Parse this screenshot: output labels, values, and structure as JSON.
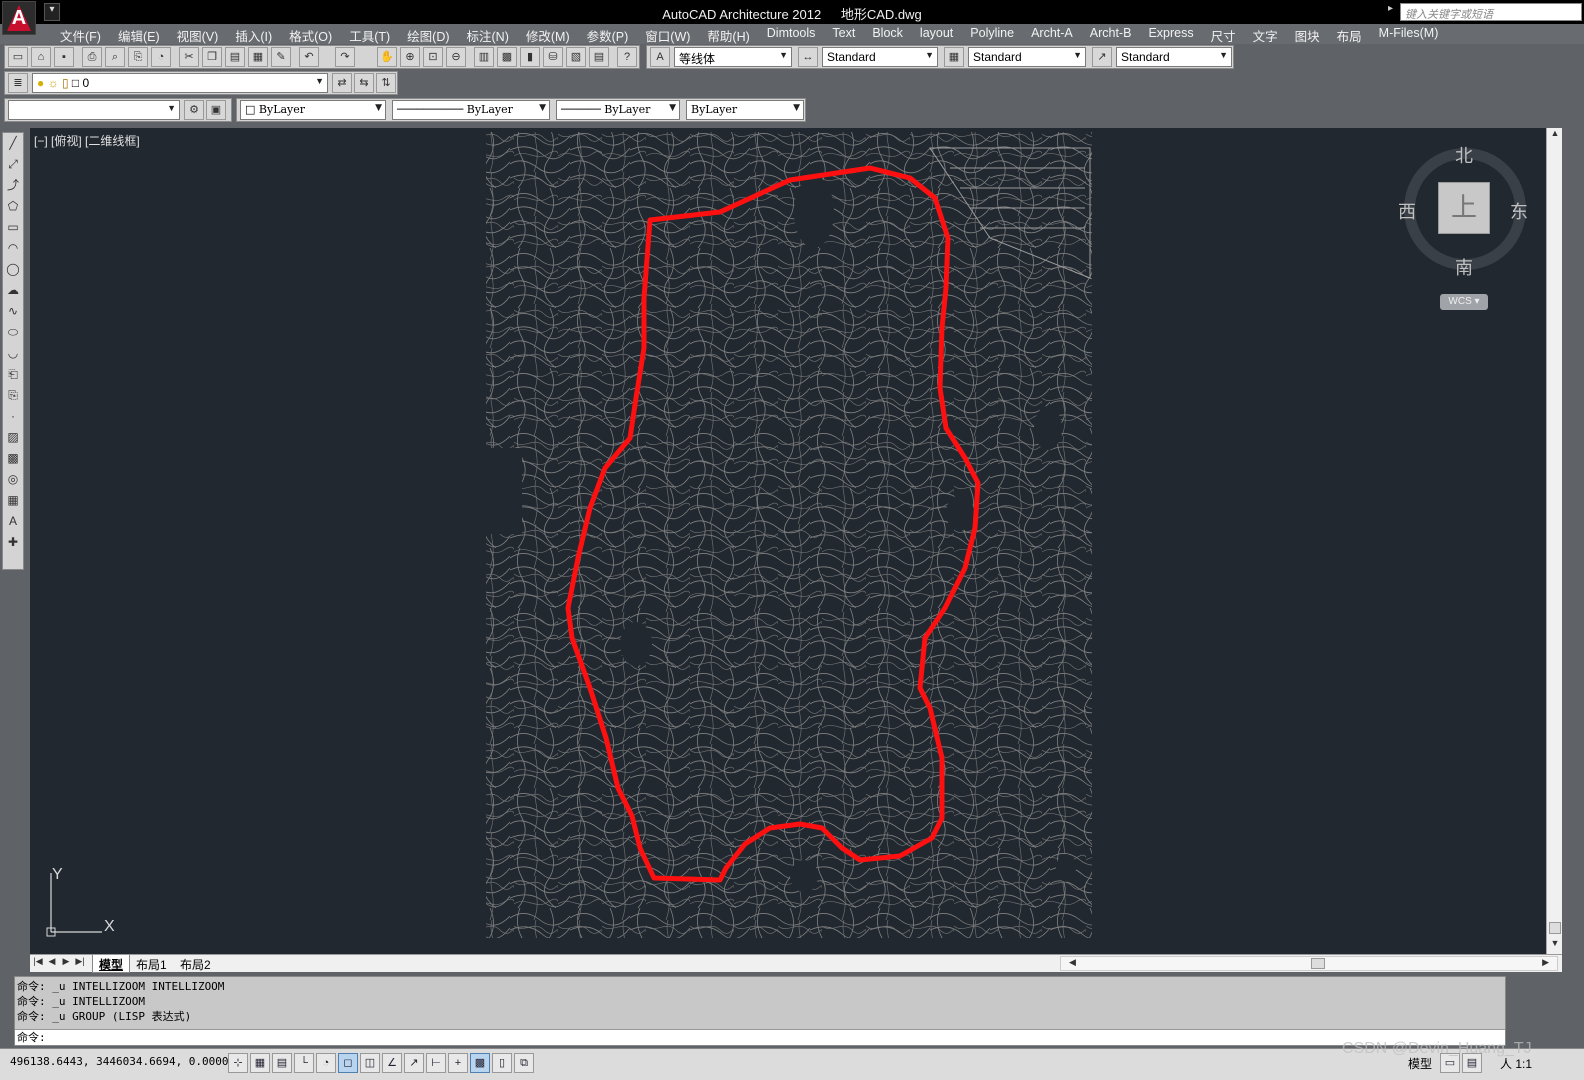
{
  "titlebar": {
    "app_name": "AutoCAD Architecture 2012",
    "file_name": "地形CAD.dwg",
    "search_placeholder": "键入关键字或短语"
  },
  "menu": [
    "文件(F)",
    "编辑(E)",
    "视图(V)",
    "插入(I)",
    "格式(O)",
    "工具(T)",
    "绘图(D)",
    "标注(N)",
    "修改(M)",
    "参数(P)",
    "窗口(W)",
    "帮助(H)",
    "Dimtools",
    "Text",
    "Block",
    "layout",
    "Polyline",
    "Archt-A",
    "Archt-B",
    "Express",
    "尺寸",
    "文字",
    "图块",
    "布局",
    "M-Files(M)"
  ],
  "toolbar": {
    "text_style": "等线体",
    "dim_style": "Standard",
    "table_style": "Standard",
    "mleader_style": "Standard",
    "layer_name": "0",
    "color": "ByLayer",
    "linetype": "ByLayer",
    "lineweight": "ByLayer",
    "plotstyle": "ByLayer"
  },
  "viewport": {
    "label": "[−] [俯视] [二维线框]",
    "accent_color": "#ff1010",
    "background": "#212830",
    "contour_color": "#8a8a8a"
  },
  "viewcube": {
    "north": "北",
    "south": "南",
    "east": "东",
    "west": "西",
    "face": "上",
    "wcs": "WCS"
  },
  "ucs": {
    "y": "Y",
    "x": "X"
  },
  "tabs": [
    "模型",
    "布局1",
    "布局2"
  ],
  "command": {
    "history": [
      "命令: _u INTELLIZOOM INTELLIZOOM",
      "命令: _u INTELLIZOOM",
      "命令: _u GROUP (LISP 表达式)"
    ],
    "prompt": "命令:"
  },
  "status": {
    "coords": "496138.6443, 3446034.6694, 0.0000",
    "model": "模型",
    "scale": "人 1:1"
  },
  "watermark": "CSDN @Devin_Huang_TJ"
}
